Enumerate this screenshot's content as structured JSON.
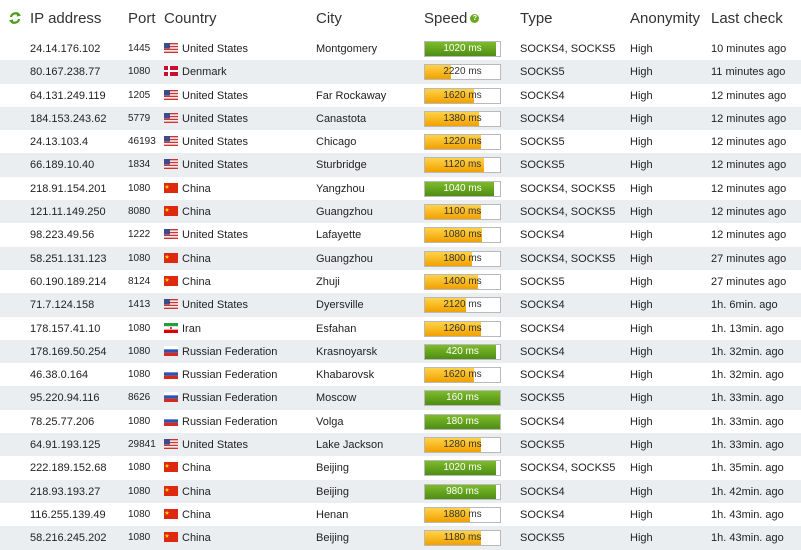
{
  "header": {
    "ip": "IP address",
    "port": "Port",
    "country": "Country",
    "city": "City",
    "speed": "Speed",
    "type": "Type",
    "anonymity": "Anonymity",
    "last_check": "Last check",
    "refresh_icon": "refresh-icon",
    "help_icon": "help-icon"
  },
  "colors": {
    "speed_fast": "#5c9a1a",
    "speed_slow": "#f5a800",
    "row_alt": "#ebeef1"
  },
  "rows": [
    {
      "ip": "24.14.176.102",
      "port": "1445",
      "flag": "us",
      "country": "United States",
      "city": "Montgomery",
      "speed": "1020 ms",
      "speed_fill": 0.95,
      "speed_color": "green",
      "type": "SOCKS4, SOCKS5",
      "anonymity": "High",
      "last_check": "10 minutes ago"
    },
    {
      "ip": "80.167.238.77",
      "port": "1080",
      "flag": "dk",
      "country": "Denmark",
      "city": "",
      "speed": "2220 ms",
      "speed_fill": 0.35,
      "speed_color": "orange",
      "type": "SOCKS5",
      "anonymity": "High",
      "last_check": "11 minutes ago"
    },
    {
      "ip": "64.131.249.119",
      "port": "1205",
      "flag": "us",
      "country": "United States",
      "city": "Far Rockaway",
      "speed": "1620 ms",
      "speed_fill": 0.65,
      "speed_color": "orange",
      "type": "SOCKS4",
      "anonymity": "High",
      "last_check": "12 minutes ago"
    },
    {
      "ip": "184.153.243.62",
      "port": "5779",
      "flag": "us",
      "country": "United States",
      "city": "Canastota",
      "speed": "1380 ms",
      "speed_fill": 0.72,
      "speed_color": "orange",
      "type": "SOCKS4",
      "anonymity": "High",
      "last_check": "12 minutes ago"
    },
    {
      "ip": "24.13.103.4",
      "port": "46193",
      "flag": "us",
      "country": "United States",
      "city": "Chicago",
      "speed": "1220 ms",
      "speed_fill": 0.75,
      "speed_color": "orange",
      "type": "SOCKS5",
      "anonymity": "High",
      "last_check": "12 minutes ago"
    },
    {
      "ip": "66.189.10.40",
      "port": "1834",
      "flag": "us",
      "country": "United States",
      "city": "Sturbridge",
      "speed": "1120 ms",
      "speed_fill": 0.78,
      "speed_color": "orange",
      "type": "SOCKS5",
      "anonymity": "High",
      "last_check": "12 minutes ago"
    },
    {
      "ip": "218.91.154.201",
      "port": "1080",
      "flag": "cn",
      "country": "China",
      "city": "Yangzhou",
      "speed": "1040 ms",
      "speed_fill": 0.92,
      "speed_color": "green",
      "type": "SOCKS4, SOCKS5",
      "anonymity": "High",
      "last_check": "12 minutes ago"
    },
    {
      "ip": "121.11.149.250",
      "port": "8080",
      "flag": "cn",
      "country": "China",
      "city": "Guangzhou",
      "speed": "1100 ms",
      "speed_fill": 0.75,
      "speed_color": "orange",
      "type": "SOCKS4, SOCKS5",
      "anonymity": "High",
      "last_check": "12 minutes ago"
    },
    {
      "ip": "98.223.49.56",
      "port": "1222",
      "flag": "us",
      "country": "United States",
      "city": "Lafayette",
      "speed": "1080 ms",
      "speed_fill": 0.76,
      "speed_color": "orange",
      "type": "SOCKS4",
      "anonymity": "High",
      "last_check": "12 minutes ago"
    },
    {
      "ip": "58.251.131.123",
      "port": "1080",
      "flag": "cn",
      "country": "China",
      "city": "Guangzhou",
      "speed": "1800 ms",
      "speed_fill": 0.62,
      "speed_color": "orange",
      "type": "SOCKS4, SOCKS5",
      "anonymity": "High",
      "last_check": "27 minutes ago"
    },
    {
      "ip": "60.190.189.214",
      "port": "8124",
      "flag": "cn",
      "country": "China",
      "city": "Zhuji",
      "speed": "1400 ms",
      "speed_fill": 0.7,
      "speed_color": "orange",
      "type": "SOCKS5",
      "anonymity": "High",
      "last_check": "27 minutes ago"
    },
    {
      "ip": "71.7.124.158",
      "port": "1413",
      "flag": "us",
      "country": "United States",
      "city": "Dyersville",
      "speed": "2120 ms",
      "speed_fill": 0.55,
      "speed_color": "orange",
      "type": "SOCKS4",
      "anonymity": "High",
      "last_check": "1h. 6min. ago"
    },
    {
      "ip": "178.157.41.10",
      "port": "1080",
      "flag": "ir",
      "country": "Iran",
      "city": "Esfahan",
      "speed": "1260 ms",
      "speed_fill": 0.75,
      "speed_color": "orange",
      "type": "SOCKS4",
      "anonymity": "High",
      "last_check": "1h. 13min. ago"
    },
    {
      "ip": "178.169.50.254",
      "port": "1080",
      "flag": "ru",
      "country": "Russian Federation",
      "city": "Krasnoyarsk",
      "speed": "420 ms",
      "speed_fill": 0.95,
      "speed_color": "green",
      "type": "SOCKS4",
      "anonymity": "High",
      "last_check": "1h. 32min. ago"
    },
    {
      "ip": "46.38.0.164",
      "port": "1080",
      "flag": "ru",
      "country": "Russian Federation",
      "city": "Khabarovsk",
      "speed": "1620 ms",
      "speed_fill": 0.65,
      "speed_color": "orange",
      "type": "SOCKS4",
      "anonymity": "High",
      "last_check": "1h. 32min. ago"
    },
    {
      "ip": "95.220.94.116",
      "port": "8626",
      "flag": "ru",
      "country": "Russian Federation",
      "city": "Moscow",
      "speed": "160 ms",
      "speed_fill": 1.0,
      "speed_color": "green",
      "type": "SOCKS5",
      "anonymity": "High",
      "last_check": "1h. 33min. ago"
    },
    {
      "ip": "78.25.77.206",
      "port": "1080",
      "flag": "ru",
      "country": "Russian Federation",
      "city": "Volga",
      "speed": "180 ms",
      "speed_fill": 1.0,
      "speed_color": "green",
      "type": "SOCKS4",
      "anonymity": "High",
      "last_check": "1h. 33min. ago"
    },
    {
      "ip": "64.91.193.125",
      "port": "29841",
      "flag": "us",
      "country": "United States",
      "city": "Lake Jackson",
      "speed": "1280 ms",
      "speed_fill": 0.75,
      "speed_color": "orange",
      "type": "SOCKS5",
      "anonymity": "High",
      "last_check": "1h. 33min. ago"
    },
    {
      "ip": "222.189.152.68",
      "port": "1080",
      "flag": "cn",
      "country": "China",
      "city": "Beijing",
      "speed": "1020 ms",
      "speed_fill": 0.95,
      "speed_color": "green",
      "type": "SOCKS4, SOCKS5",
      "anonymity": "High",
      "last_check": "1h. 35min. ago"
    },
    {
      "ip": "218.93.193.27",
      "port": "1080",
      "flag": "cn",
      "country": "China",
      "city": "Beijing",
      "speed": "980 ms",
      "speed_fill": 0.95,
      "speed_color": "green",
      "type": "SOCKS4",
      "anonymity": "High",
      "last_check": "1h. 42min. ago"
    },
    {
      "ip": "116.255.139.49",
      "port": "1080",
      "flag": "cn",
      "country": "China",
      "city": "Henan",
      "speed": "1880 ms",
      "speed_fill": 0.6,
      "speed_color": "orange",
      "type": "SOCKS4",
      "anonymity": "High",
      "last_check": "1h. 43min. ago"
    },
    {
      "ip": "58.216.245.202",
      "port": "1080",
      "flag": "cn",
      "country": "China",
      "city": "Beijing",
      "speed": "1180 ms",
      "speed_fill": 0.75,
      "speed_color": "orange",
      "type": "SOCKS5",
      "anonymity": "High",
      "last_check": "1h. 43min. ago"
    }
  ]
}
